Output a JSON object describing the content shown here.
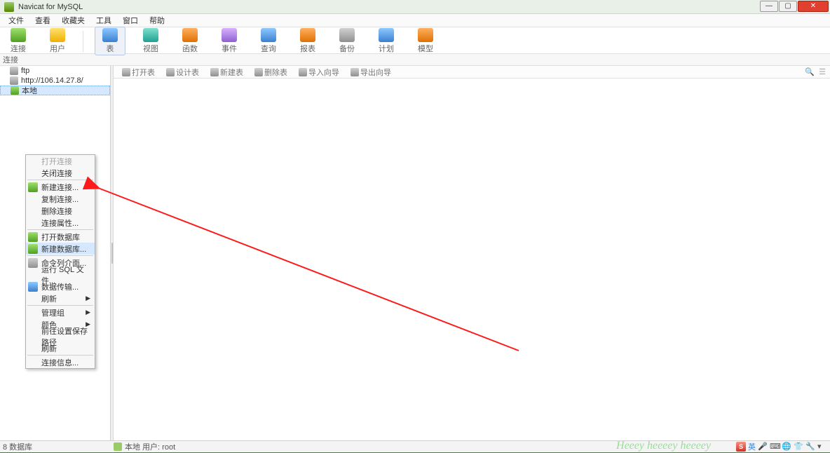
{
  "window": {
    "title": "Navicat for MySQL"
  },
  "menubar": [
    "文件",
    "查看",
    "收藏夹",
    "工具",
    "窗口",
    "帮助"
  ],
  "toolbar": [
    {
      "key": "connect",
      "label": "连接",
      "color": "c-green"
    },
    {
      "key": "user",
      "label": "用户",
      "color": "c-yellow"
    },
    {
      "key": "table",
      "label": "表",
      "color": "c-blue",
      "active": true
    },
    {
      "key": "view",
      "label": "视图",
      "color": "c-teal"
    },
    {
      "key": "func",
      "label": "函数",
      "color": "c-orange"
    },
    {
      "key": "event",
      "label": "事件",
      "color": "c-purple"
    },
    {
      "key": "query",
      "label": "查询",
      "color": "c-blue"
    },
    {
      "key": "report",
      "label": "报表",
      "color": "c-orange"
    },
    {
      "key": "backup",
      "label": "备份",
      "color": "c-gray"
    },
    {
      "key": "schedule",
      "label": "计划",
      "color": "c-blue"
    },
    {
      "key": "model",
      "label": "模型",
      "color": "c-orange"
    }
  ],
  "conn_row_label": "连接",
  "tree": {
    "items": [
      {
        "label": "ftp",
        "icon": "c-gray"
      },
      {
        "label": "http://106.14.27.8/",
        "icon": "c-gray"
      },
      {
        "label": "本地",
        "icon": "c-green",
        "selected": true
      }
    ]
  },
  "context_menu": [
    {
      "label": "打开连接",
      "disabled": true
    },
    {
      "label": "关闭连接"
    },
    {
      "sep": true
    },
    {
      "label": "新建连接...",
      "icon": "c-green"
    },
    {
      "label": "复制连接..."
    },
    {
      "label": "删除连接"
    },
    {
      "label": "连接属性..."
    },
    {
      "sep": true
    },
    {
      "label": "打开数据库",
      "icon": "c-green"
    },
    {
      "label": "新建数据库...",
      "icon": "c-green",
      "highlight": true
    },
    {
      "sep": true
    },
    {
      "label": "命令列介面...",
      "icon": "c-gray"
    },
    {
      "label": "运行 SQL 文件..."
    },
    {
      "label": "数据传输...",
      "icon": "c-blue"
    },
    {
      "label": "刷新",
      "submenu": true
    },
    {
      "sep": true
    },
    {
      "label": "管理组",
      "submenu": true
    },
    {
      "label": "颜色",
      "submenu": true
    },
    {
      "label": "前往设置保存路径"
    },
    {
      "label": "刷新"
    },
    {
      "sep": true
    },
    {
      "label": "连接信息..."
    }
  ],
  "sub_toolbar": [
    {
      "label": "打开表"
    },
    {
      "label": "设计表"
    },
    {
      "label": "新建表"
    },
    {
      "label": "删除表"
    },
    {
      "label": "导入向导"
    },
    {
      "label": "导出向导"
    }
  ],
  "statusbar": {
    "left": "8 数据库",
    "right": "本地  用户: root"
  },
  "watermark": "Heeey heeeey heeeey",
  "tray": {
    "ime_badge": "S",
    "lang": "英"
  }
}
